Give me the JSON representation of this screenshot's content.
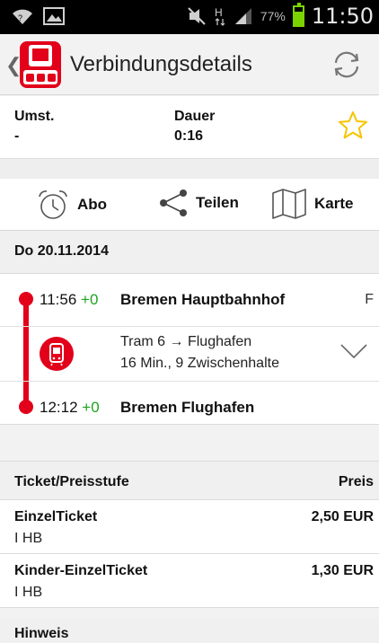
{
  "statusbar": {
    "battery_percent": "77%",
    "time": "11:50",
    "icons": [
      "wifi-icon",
      "image-icon",
      "mute-icon",
      "data-transfer-icon",
      "signal-icon",
      "battery-icon"
    ]
  },
  "actionbar": {
    "title": "Verbindungsdetails",
    "back_icon": "chevron-left-icon",
    "refresh_icon": "refresh-icon"
  },
  "summary": {
    "umst_label": "Umst.",
    "umst_value": "-",
    "dauer_label": "Dauer",
    "dauer_value": "0:16",
    "favorite_icon": "star-icon"
  },
  "actions": [
    {
      "label": "Abo",
      "icon": "alarm-clock-icon"
    },
    {
      "label": "Teilen",
      "icon": "share-icon"
    },
    {
      "label": "Karte",
      "icon": "map-icon"
    }
  ],
  "date": "Do 20.11.2014",
  "journey": {
    "departure": {
      "time": "11:56",
      "delay": "+0",
      "station": "Bremen Hauptbahnhof",
      "platform": "F"
    },
    "leg": {
      "line": "Tram 6 → Flughafen",
      "details": "16 Min., 9 Zwischenhalte"
    },
    "arrival": {
      "time": "12:12",
      "delay": "+0",
      "station": "Bremen Flughafen"
    }
  },
  "tickets": {
    "header_left": "Ticket/Preisstufe",
    "header_right": "Preis",
    "rows": [
      {
        "name": "EinzelTicket",
        "zone": "I HB",
        "price": "2,50 EUR"
      },
      {
        "name": "Kinder-EinzelTicket",
        "zone": "I HB",
        "price": "1,30 EUR"
      }
    ]
  },
  "hinweis_label": "Hinweis",
  "colors": {
    "accent": "#e2001a",
    "delay_green": "#1fa31f",
    "star": "#f5c400"
  }
}
